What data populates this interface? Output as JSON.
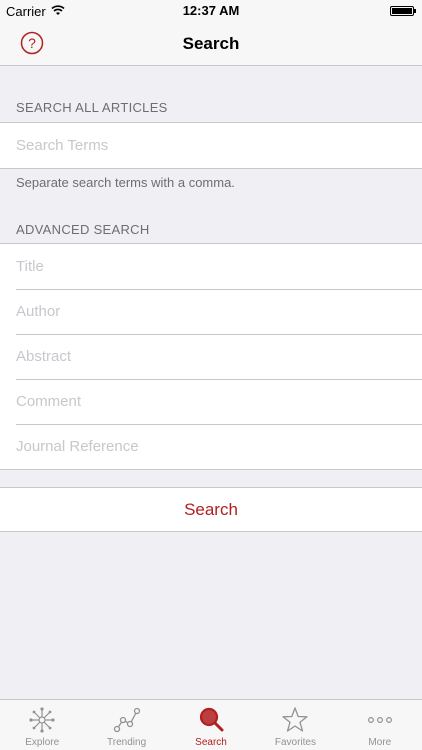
{
  "status_bar": {
    "carrier": "Carrier",
    "time": "12:37 AM"
  },
  "nav": {
    "title": "Search",
    "help_icon": "question-circle-icon"
  },
  "colors": {
    "accent": "#b21f1f",
    "placeholder": "#c7c7cd",
    "section_text": "#6d6d72"
  },
  "search_all": {
    "header": "SEARCH ALL ARTICLES",
    "placeholder": "Search Terms",
    "value": "",
    "footer": "Separate search terms with a comma."
  },
  "advanced": {
    "header": "ADVANCED SEARCH",
    "fields": [
      {
        "placeholder": "Title",
        "value": ""
      },
      {
        "placeholder": "Author",
        "value": ""
      },
      {
        "placeholder": "Abstract",
        "value": ""
      },
      {
        "placeholder": "Comment",
        "value": ""
      },
      {
        "placeholder": "Journal Reference",
        "value": ""
      }
    ]
  },
  "search_button": {
    "label": "Search"
  },
  "tabs": [
    {
      "label": "Explore",
      "icon": "explore-icon",
      "active": false
    },
    {
      "label": "Trending",
      "icon": "trending-icon",
      "active": false
    },
    {
      "label": "Search",
      "icon": "search-icon",
      "active": true
    },
    {
      "label": "Favorites",
      "icon": "star-icon",
      "active": false
    },
    {
      "label": "More",
      "icon": "more-icon",
      "active": false
    }
  ]
}
